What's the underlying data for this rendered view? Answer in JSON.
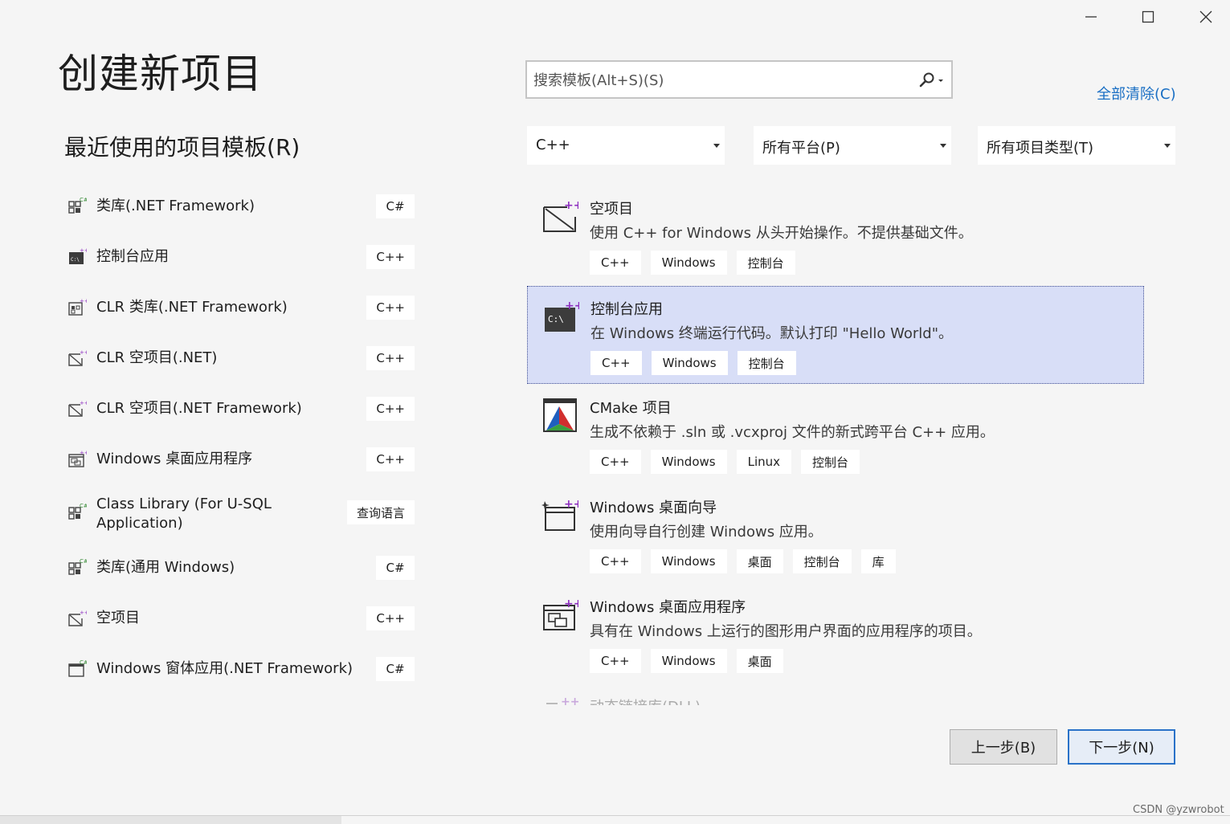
{
  "window": {
    "minimize_icon": "minimize-icon",
    "maximize_icon": "maximize-icon",
    "close_icon": "close-icon"
  },
  "header": {
    "title": "创建新项目",
    "recent_heading": "最近使用的项目模板",
    "recent_heading_key": "(R)"
  },
  "search": {
    "placeholder": "搜索模板(Alt+S)(S)",
    "icon": "search-icon"
  },
  "clear_all": {
    "label": "全部清除(C)"
  },
  "filters": {
    "language": {
      "selected": "C++"
    },
    "platform": {
      "selected": "所有平台(P)"
    },
    "project_type": {
      "selected": "所有项目类型(T)"
    }
  },
  "recent": [
    {
      "name": "类库(.NET Framework)",
      "lang": "C#",
      "icon": "class-library-icon"
    },
    {
      "name": "控制台应用",
      "lang": "C++",
      "icon": "console-app-icon"
    },
    {
      "name": "CLR 类库(.NET Framework)",
      "lang": "C++",
      "icon": "clr-library-icon"
    },
    {
      "name": "CLR 空项目(.NET)",
      "lang": "C++",
      "icon": "empty-project-icon"
    },
    {
      "name": "CLR 空项目(.NET Framework)",
      "lang": "C++",
      "icon": "empty-project-icon"
    },
    {
      "name": "Windows 桌面应用程序",
      "lang": "C++",
      "icon": "desktop-app-icon"
    },
    {
      "name_line1": "Class Library (For U-SQL",
      "name_line2": "Application)",
      "lang": "查询语言",
      "icon": "class-library-icon"
    },
    {
      "name": "类库(通用 Windows)",
      "lang": "C#",
      "icon": "class-library-icon"
    },
    {
      "name": "空项目",
      "lang": "C++",
      "icon": "empty-project-icon"
    },
    {
      "name": "Windows 窗体应用(.NET Framework)",
      "lang": "C#",
      "icon": "winforms-icon"
    }
  ],
  "templates": [
    {
      "name": "空项目",
      "desc": "使用 C++ for Windows 从头开始操作。不提供基础文件。",
      "tags": [
        "C++",
        "Windows",
        "控制台"
      ],
      "icon": "empty-project-icon"
    },
    {
      "name": "控制台应用",
      "desc": "在 Windows 终端运行代码。默认打印 \"Hello World\"。",
      "tags": [
        "C++",
        "Windows",
        "控制台"
      ],
      "icon": "console-app-icon",
      "selected": true
    },
    {
      "name": "CMake 项目",
      "desc": "生成不依赖于 .sln 或 .vcxproj 文件的新式跨平台 C++ 应用。",
      "tags": [
        "C++",
        "Windows",
        "Linux",
        "控制台"
      ],
      "icon": "cmake-icon"
    },
    {
      "name": "Windows 桌面向导",
      "desc": "使用向导自行创建 Windows 应用。",
      "tags": [
        "C++",
        "Windows",
        "桌面",
        "控制台",
        "库"
      ],
      "icon": "desktop-wizard-icon"
    },
    {
      "name": "Windows 桌面应用程序",
      "desc": "具有在 Windows 上运行的图形用户界面的应用程序的项目。",
      "tags": [
        "C++",
        "Windows",
        "桌面"
      ],
      "icon": "desktop-app-icon"
    }
  ],
  "partial_template": {
    "name": "动态链接库(DLL)"
  },
  "buttons": {
    "back": "上一步(B)",
    "next": "下一步(N)"
  },
  "watermark": "CSDN @yzwrobot",
  "colors": {
    "accent": "#1a6fc4",
    "selection": "#d8def7",
    "next_border": "#2a72c8",
    "cpp_plus": "#8c2dbf"
  }
}
